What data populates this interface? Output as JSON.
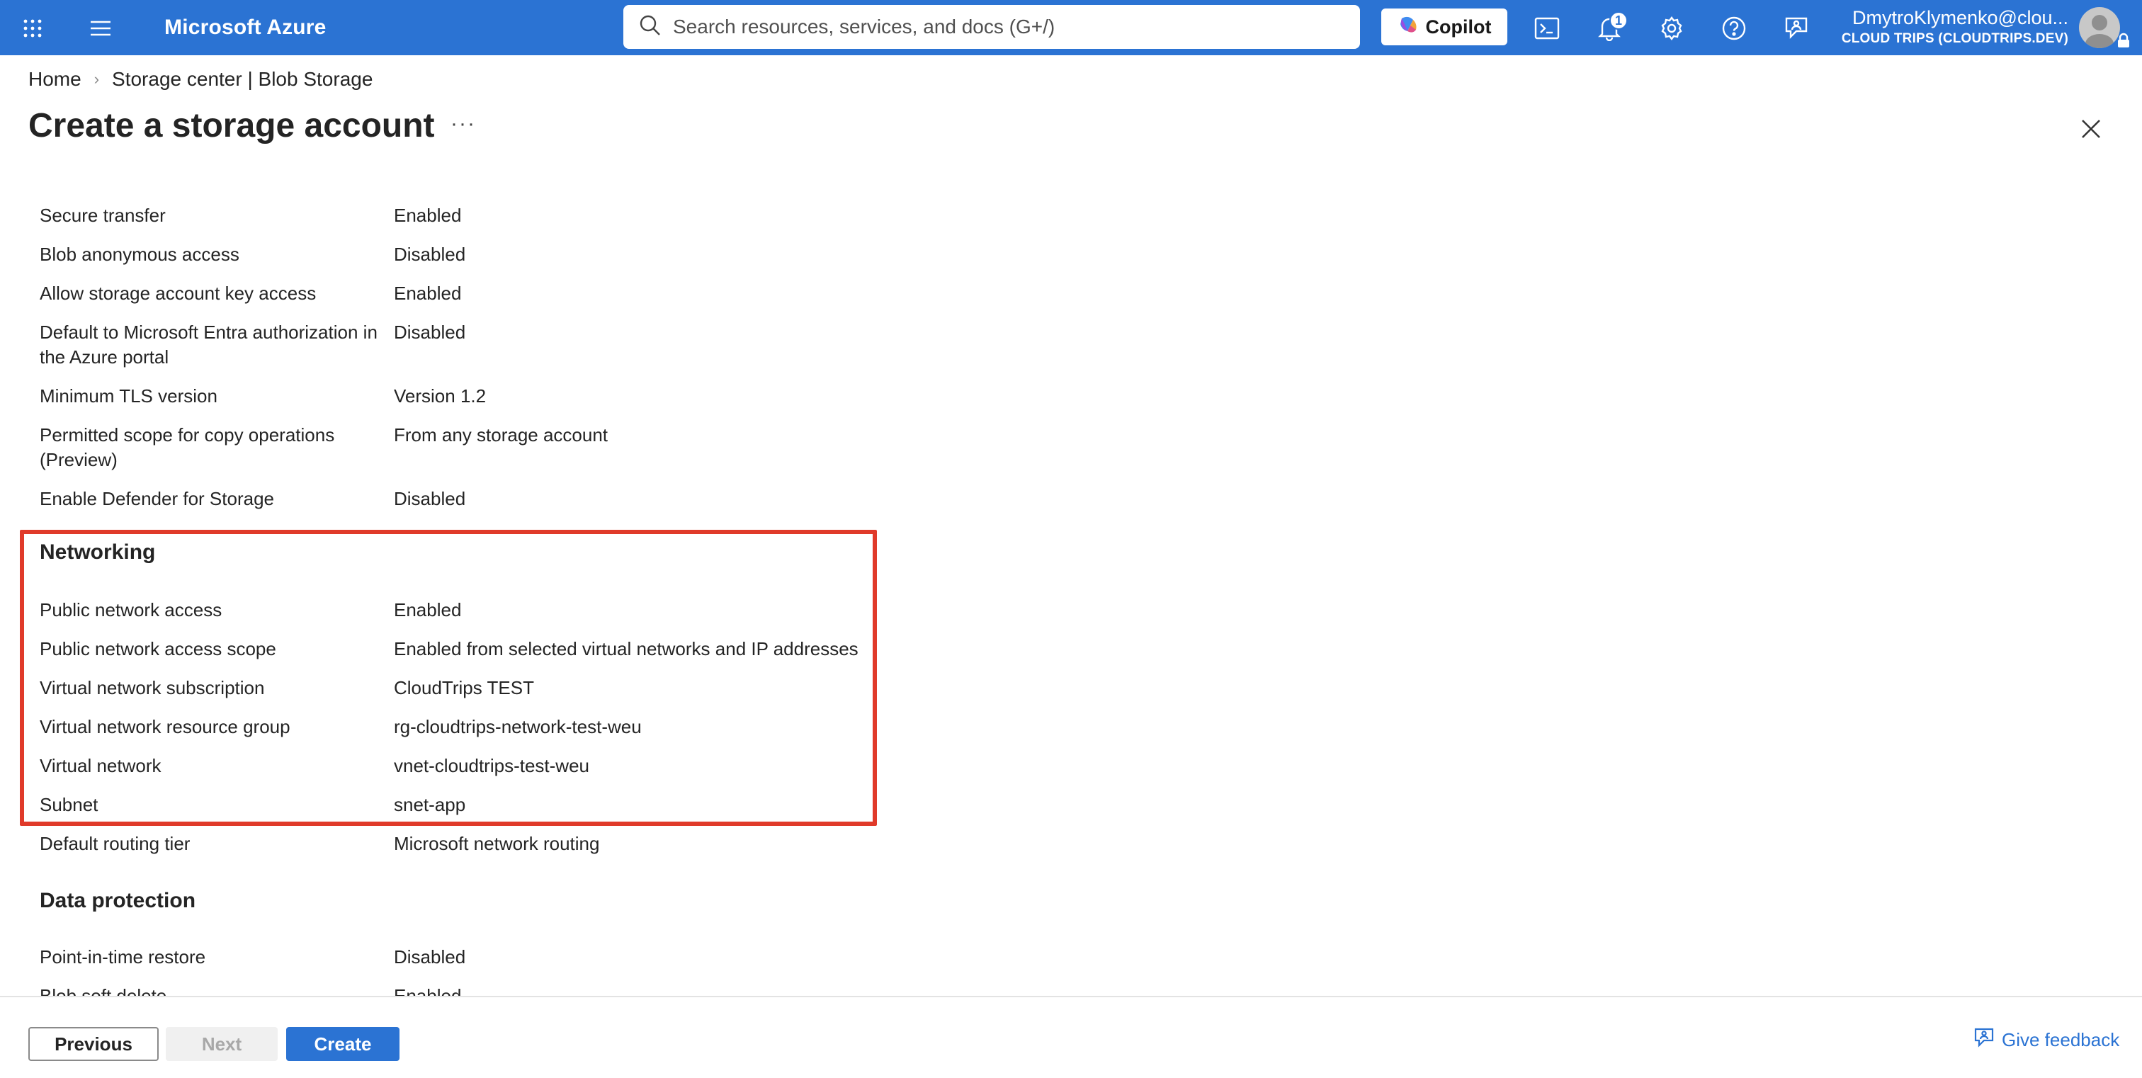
{
  "topbar": {
    "brand": "Microsoft Azure",
    "search_placeholder": "Search resources, services, and docs (G+/)",
    "copilot_label": "Copilot",
    "notification_count": "1",
    "account_name": "DmytroKlymenko@clou...",
    "account_tenant": "CLOUD TRIPS (CLOUDTRIPS.DEV)",
    "bar_color": "#2b73d3"
  },
  "breadcrumb": {
    "home": "Home",
    "parent": "Storage center | Blob Storage",
    "separator": "›"
  },
  "page": {
    "title": "Create a storage account",
    "more": "···"
  },
  "security_rows": [
    {
      "label": "Secure transfer",
      "value": "Enabled"
    },
    {
      "label": "Blob anonymous access",
      "value": "Disabled"
    },
    {
      "label": "Allow storage account key access",
      "value": "Enabled"
    },
    {
      "label": "Default to Microsoft Entra authorization in the Azure portal",
      "value": "Disabled"
    },
    {
      "label": "Minimum TLS version",
      "value": "Version 1.2"
    },
    {
      "label": "Permitted scope for copy operations (Preview)",
      "value": "From any storage account"
    },
    {
      "label": "Enable Defender for Storage",
      "value": "Disabled"
    }
  ],
  "networking": {
    "title": "Networking",
    "rows": [
      {
        "label": "Public network access",
        "value": "Enabled"
      },
      {
        "label": "Public network access scope",
        "value": "Enabled from selected virtual networks and IP addresses"
      },
      {
        "label": "Virtual network subscription",
        "value": "CloudTrips TEST"
      },
      {
        "label": "Virtual network resource group",
        "value": "rg-cloudtrips-network-test-weu"
      },
      {
        "label": "Virtual network",
        "value": "vnet-cloudtrips-test-weu"
      },
      {
        "label": "Subnet",
        "value": "snet-app"
      },
      {
        "label": "Default routing tier",
        "value": "Microsoft network routing"
      }
    ],
    "highlight_color": "#e03a2a"
  },
  "data_protection": {
    "title": "Data protection",
    "rows": [
      {
        "label": "Point-in-time restore",
        "value": "Disabled"
      },
      {
        "label": "Blob soft delete",
        "value": "Enabled"
      }
    ]
  },
  "footer": {
    "previous": "Previous",
    "next": "Next",
    "create": "Create",
    "feedback": "Give feedback"
  }
}
